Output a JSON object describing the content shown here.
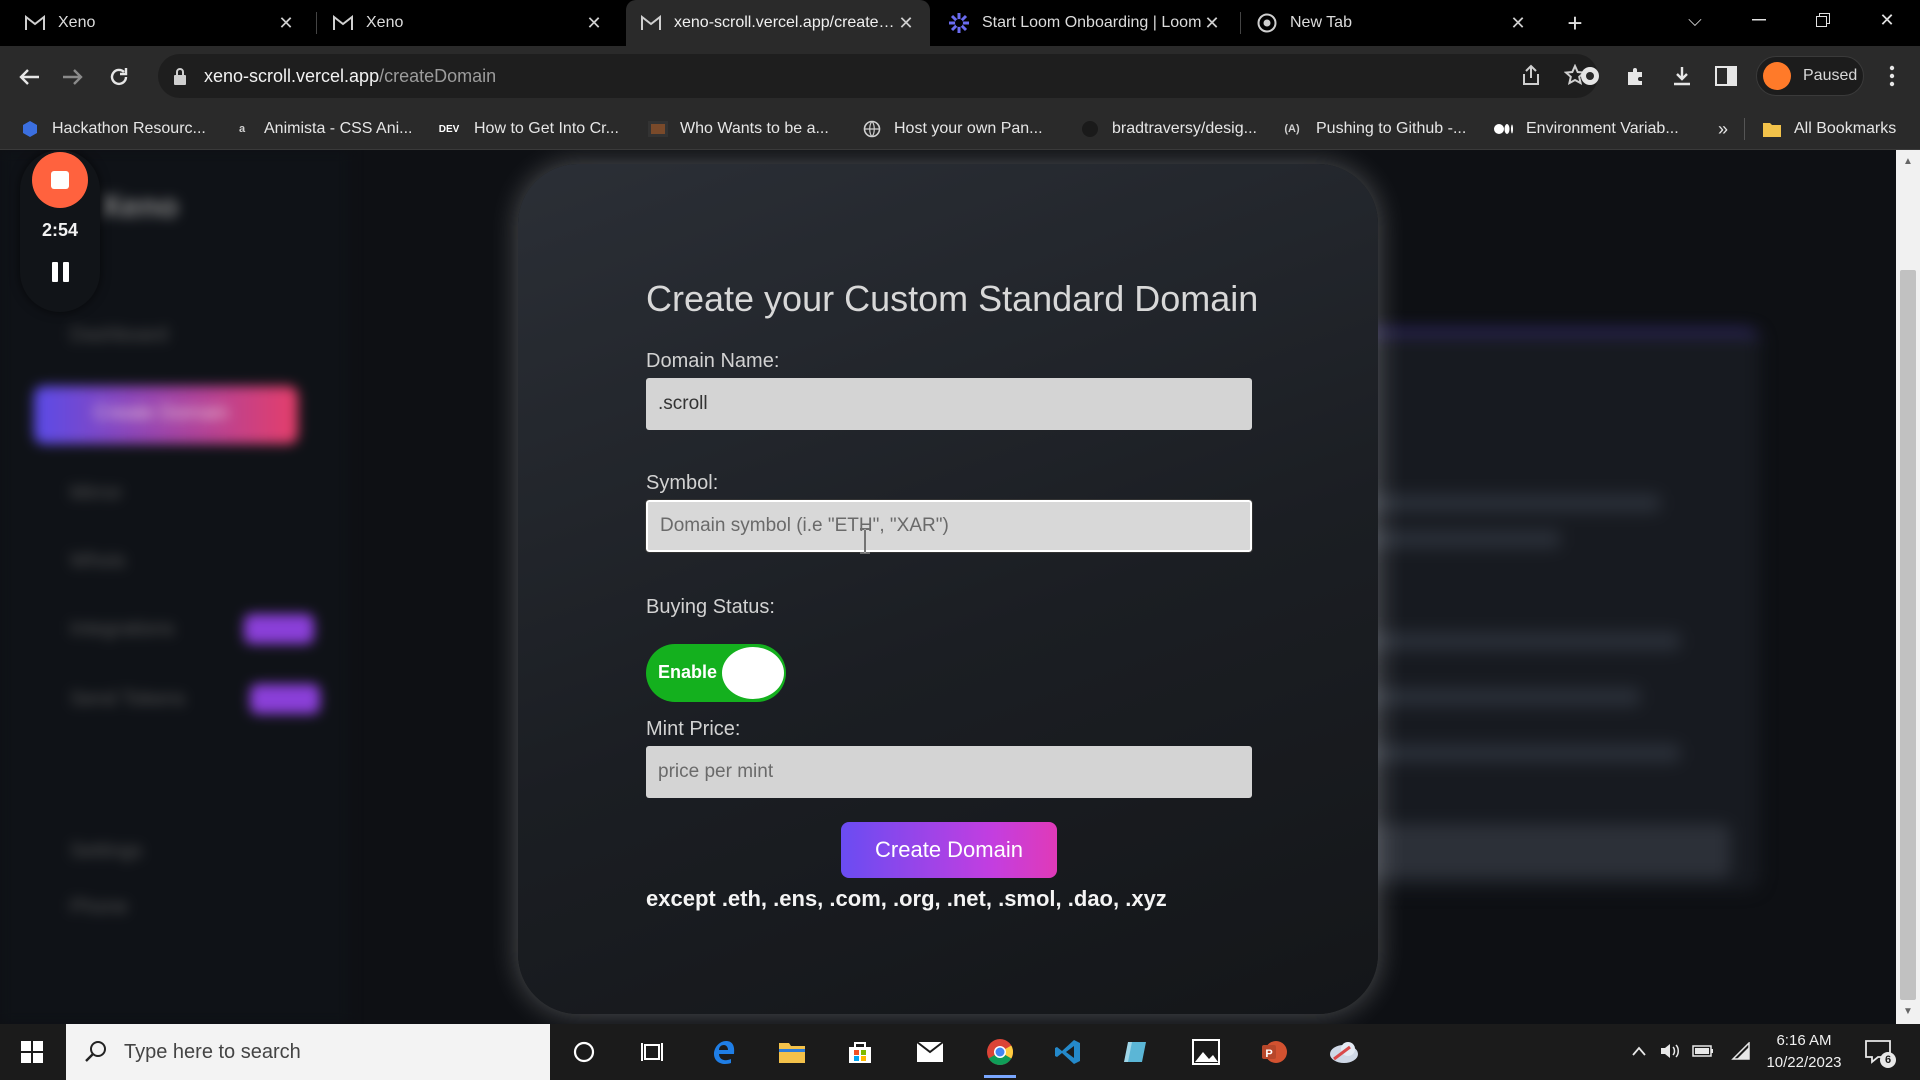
{
  "browser": {
    "tabs": [
      {
        "title": "Xeno",
        "active": false,
        "favicon": "gmail-m-icon"
      },
      {
        "title": "Xeno",
        "active": false,
        "favicon": "gmail-m-icon"
      },
      {
        "title": "xeno-scroll.vercel.app/createDomain",
        "active": true,
        "favicon": "gmail-m-icon"
      },
      {
        "title": "Start Loom Onboarding | Loom",
        "active": false,
        "favicon": "loom-icon"
      },
      {
        "title": "New Tab",
        "active": false,
        "favicon": "chrome-icon"
      }
    ],
    "address": {
      "host": "xeno-scroll.vercel.app",
      "path": "/createDomain"
    },
    "profile_status": "Paused",
    "bookmarks": [
      "Hackathon Resourc...",
      "Animista - CSS Ani...",
      "How to Get Into Cr...",
      "Who Wants to be a...",
      "Host your own Pan...",
      "bradtraversy/desig...",
      "Pushing to Github -...",
      "Environment Variab..."
    ],
    "bookmarks_overflow": "»",
    "all_bookmarks": "All Bookmarks"
  },
  "recorder": {
    "time": "2:54"
  },
  "background_app": {
    "logo": "Xeno",
    "nav": [
      "Dashboard",
      "Create Domain",
      "Mirror",
      "Whois",
      "Integrations",
      "Send Tokens",
      "Settings",
      "Phone"
    ]
  },
  "form": {
    "title": "Create your Custom Standard Domain",
    "domain_label": "Domain Name:",
    "domain_value": ".scroll",
    "symbol_label": "Symbol:",
    "symbol_placeholder": "Domain symbol (i.e \"ETH\", \"XAR\")",
    "buying_label": "Buying Status:",
    "toggle_label": "Enable",
    "mint_label": "Mint Price:",
    "mint_placeholder": "price per mint",
    "submit_label": "Create Domain",
    "note": "except .eth, .ens, .com, .org, .net, .smol, .dao, .xyz"
  },
  "taskbar": {
    "search_placeholder": "Type here to search",
    "time": "6:16 AM",
    "date": "10/22/2023",
    "notification_count": "6"
  },
  "colors": {
    "toggle_on": "#14b01e",
    "button_gradient_start": "#6a4cf2",
    "button_gradient_end": "#e03ab8",
    "recorder_red": "#ff623e"
  }
}
